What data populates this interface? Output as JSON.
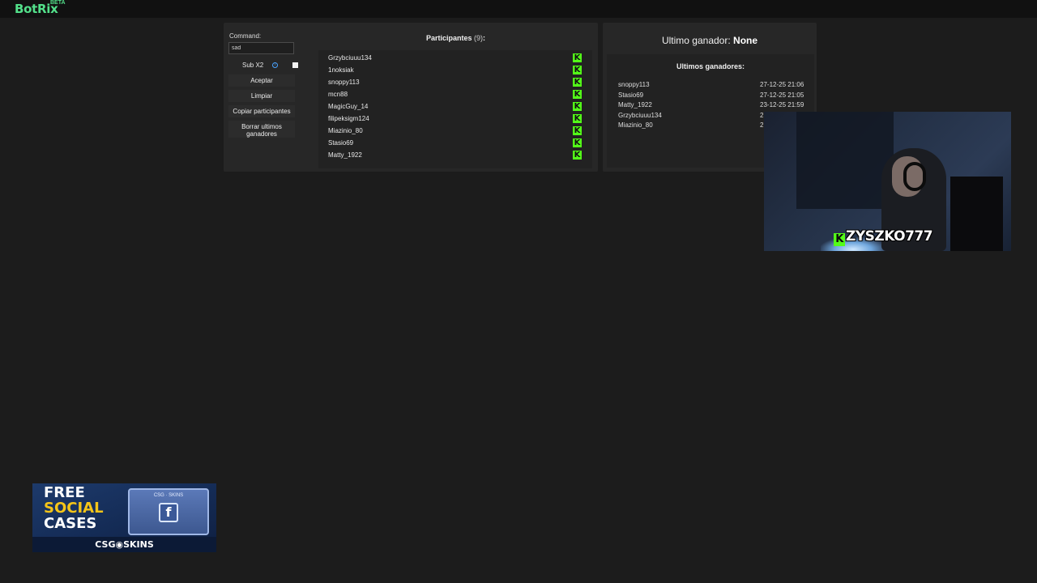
{
  "app": {
    "logo": "BotRix",
    "logo_badge": "BETA"
  },
  "controls": {
    "command_label": "Command:",
    "command_value": "sad",
    "sub_label": "Sub X2",
    "sub_checked": true,
    "buttons": {
      "accept": "Aceptar",
      "clear": "Limpiar",
      "copy": "Copiar participantes",
      "delete_winners": "Borrar ultimos ganadores"
    }
  },
  "participants": {
    "title": "Participantes",
    "count": "(9)",
    "colon": ":",
    "platform_icon": "kick-icon",
    "list": [
      "Grzybciuuu134",
      "1noksiak",
      "snoppy113",
      "mcn88",
      "MagicGuy_14",
      "filipeksigm124",
      "Miazinio_80",
      "Stasio69",
      "Matty_1922"
    ]
  },
  "winners": {
    "last_winner_label": "Ultimo ganador:",
    "last_winner_value": "None",
    "recent_title": "Ultimos ganadores:",
    "recent": [
      {
        "name": "snoppy113",
        "date": "27-12-25 21:06"
      },
      {
        "name": "Stasio69",
        "date": "27-12-25 21:05"
      },
      {
        "name": "Matty_1922",
        "date": "23-12-25 21:59"
      },
      {
        "name": "Grzybciuuu134",
        "date": "2"
      },
      {
        "name": "Miazinio_80",
        "date": "2"
      }
    ]
  },
  "webcam": {
    "streamer_name": "ZYSZKO777"
  },
  "ad": {
    "line1": "FREE",
    "line2": "SOCIAL",
    "line3": "CASES",
    "box_label": "CSG · SKINS",
    "brand": "CSG◉SKINS"
  },
  "colors": {
    "accent": "#53e08a",
    "kick_green": "#53fc18",
    "background": "#1c1c1c",
    "panel": "#272727"
  }
}
